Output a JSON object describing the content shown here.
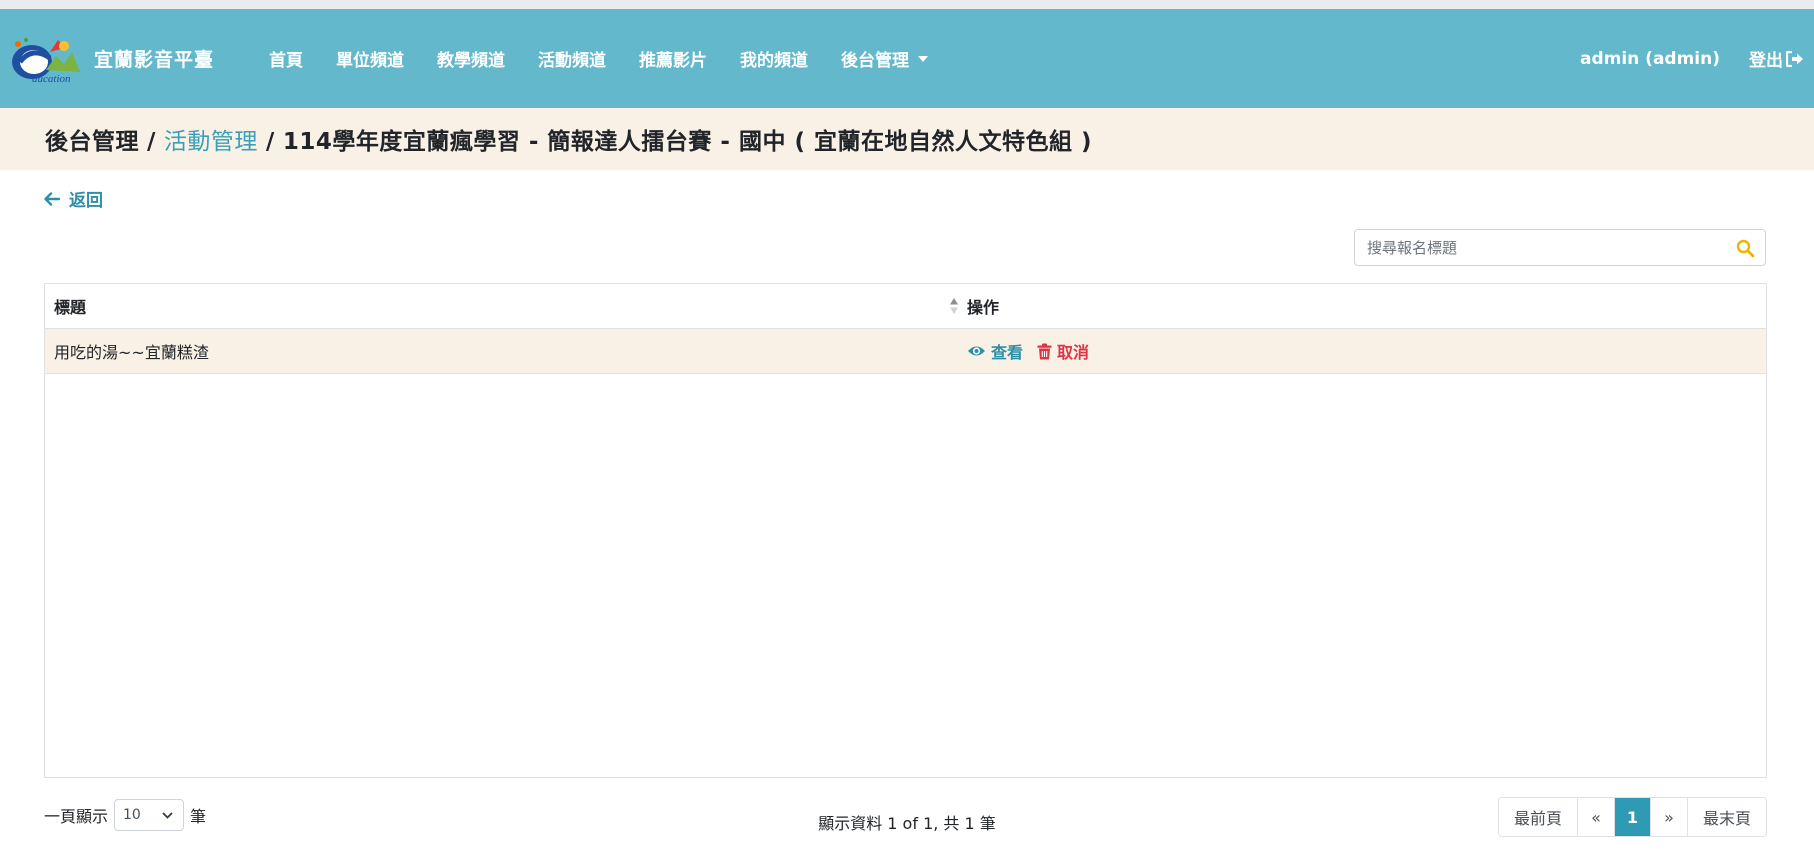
{
  "colors": {
    "navbar": "#63b8cc",
    "breadcrumb_bg": "#faf1e6",
    "link": "#3aa0b9",
    "danger": "#dc3545",
    "active_page": "#2e9ab3",
    "search_icon": "#f0b400"
  },
  "brand": {
    "name": "宜蘭影音平臺",
    "logo_icon": "education-logo"
  },
  "nav": {
    "items": [
      "首頁",
      "單位頻道",
      "教學頻道",
      "活動頻道",
      "推薦影片",
      "我的頻道"
    ],
    "admin_menu": "後台管理",
    "user": "admin (admin)",
    "logout": "登出"
  },
  "breadcrumb": {
    "root": "後台管理",
    "sep": "/",
    "link": "活動管理",
    "current": "114學年度宜蘭瘋學習 - 簡報達人擂台賽 - 國中 ( 宜蘭在地自然人文特色組 )"
  },
  "back": {
    "label": "返回",
    "icon": "arrow-left-icon"
  },
  "search": {
    "placeholder": "搜尋報名標題",
    "icon": "search-icon"
  },
  "table": {
    "headers": {
      "title": "標題",
      "actions": "操作"
    },
    "rows": [
      {
        "title": "用吃的湯~~宜蘭糕渣",
        "view": "查看",
        "cancel": "取消"
      }
    ]
  },
  "footer": {
    "per_page_prefix": "一頁顯示",
    "per_page_value": "10",
    "per_page_suffix": "筆",
    "info": "顯示資料 1 of 1, 共 1 筆",
    "pager": {
      "first": "最前頁",
      "prev": "«",
      "current": "1",
      "next": "»",
      "last": "最末頁"
    }
  }
}
